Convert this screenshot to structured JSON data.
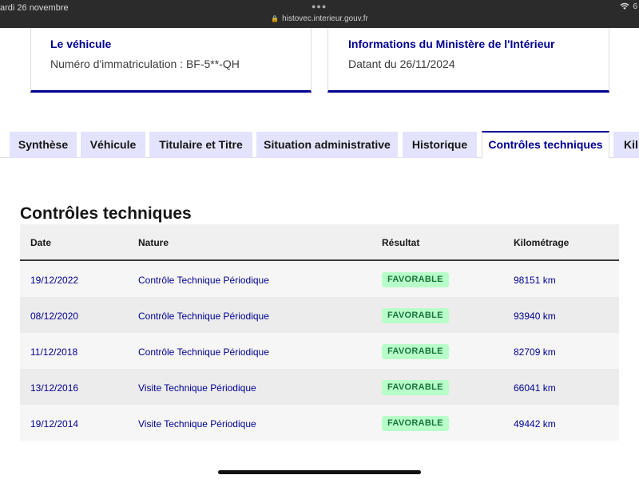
{
  "status_bar": {
    "time": "ardi 26 novembre",
    "url": "histovec.interieur.gouv.fr",
    "right": "6"
  },
  "cards": {
    "vehicle": {
      "title": "Le véhicule",
      "text": "Numéro d'immatriculation : BF-5**-QH"
    },
    "ministry": {
      "title": "Informations du Ministère de l'Intérieur",
      "text": "Datant du 26/11/2024"
    }
  },
  "tabs": [
    {
      "label": "Synthèse"
    },
    {
      "label": "Véhicule"
    },
    {
      "label": "Titulaire et Titre"
    },
    {
      "label": "Situation administrative"
    },
    {
      "label": "Historique"
    },
    {
      "label": "Contrôles techniques",
      "active": true
    },
    {
      "label": "Kil"
    }
  ],
  "section": {
    "title": "Contrôles techniques"
  },
  "table": {
    "headers": [
      "Date",
      "Nature",
      "Résultat",
      "Kilométrage"
    ],
    "rows": [
      {
        "date": "19/12/2022",
        "nature": "Contrôle Technique Périodique",
        "result": "FAVORABLE",
        "km": "98151 km"
      },
      {
        "date": "08/12/2020",
        "nature": "Contrôle Technique Périodique",
        "result": "FAVORABLE",
        "km": "93940 km"
      },
      {
        "date": "11/12/2018",
        "nature": "Contrôle Technique Périodique",
        "result": "FAVORABLE",
        "km": "82709 km"
      },
      {
        "date": "13/12/2016",
        "nature": "Visite Technique Périodique",
        "result": "FAVORABLE",
        "km": "66041 km"
      },
      {
        "date": "19/12/2014",
        "nature": "Visite Technique Périodique",
        "result": "FAVORABLE",
        "km": "49442 km"
      }
    ]
  },
  "colors": {
    "accent": "#000091",
    "tab_bg": "#e3e3fd",
    "success_bg": "#b8fec9",
    "success_text": "#18753c"
  }
}
